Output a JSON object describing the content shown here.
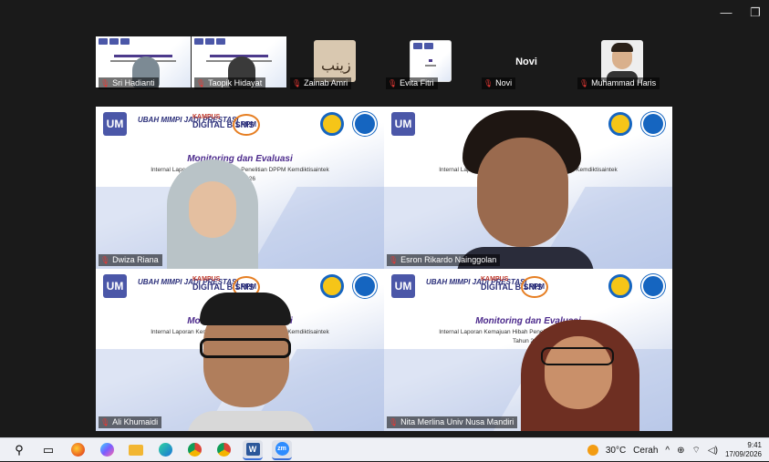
{
  "window": {
    "controls": [
      "minimize",
      "restore"
    ]
  },
  "participants_strip": [
    {
      "name": "Sri Hadianti",
      "muted": true,
      "type": "video"
    },
    {
      "name": "Taopik Hidayat",
      "muted": true,
      "type": "video"
    },
    {
      "name": "Zainab Amri",
      "muted": true,
      "type": "avatar"
    },
    {
      "name": "Evita Fitri",
      "muted": true,
      "type": "avatar"
    },
    {
      "name": "Novi",
      "muted": true,
      "type": "name-only",
      "display_text": "Novi"
    },
    {
      "name": "Muhammad Haris",
      "muted": true,
      "type": "avatar"
    }
  ],
  "slide": {
    "title": "Monitoring dan Evaluasi",
    "subtitle": "Internal Laporan Kemajuan Hibah Penelitian DPPM Kemdiktisaintek",
    "year": "Tahun 2026",
    "logo_tagline": "UBAH MIMPI JADI PRESTASI",
    "logo_kampus": "KAMPUS",
    "logo_digital": "DIGITAL BISNIS",
    "logo_lppm": "LPPM",
    "logo_um": "UM"
  },
  "grid": [
    {
      "name": "Dwiza Riana",
      "muted": true,
      "active": false
    },
    {
      "name": "Esron Rikardo Nainggolan",
      "muted": true,
      "active": false
    },
    {
      "name": "Ali Khumaidi",
      "muted": true,
      "active": true
    },
    {
      "name": "Nita Merlina Univ Nusa Mandiri",
      "muted": true,
      "active": false
    }
  ],
  "taskbar": {
    "apps": [
      "search-icon",
      "task-view-icon",
      "firefox-icon",
      "copilot-icon",
      "file-explorer-icon",
      "edge-icon",
      "chrome-icon",
      "chrome-profile-icon",
      "word-icon",
      "zoom-icon"
    ],
    "weather": {
      "temp": "30°C",
      "condition": "Cerah"
    },
    "time": "9:41",
    "date": "17/09/2026"
  },
  "icons": {
    "mute": "⁂"
  },
  "colors": {
    "active_border": "#2ecc71",
    "slide_title": "#4c2a8c",
    "mute": "#e53935"
  }
}
